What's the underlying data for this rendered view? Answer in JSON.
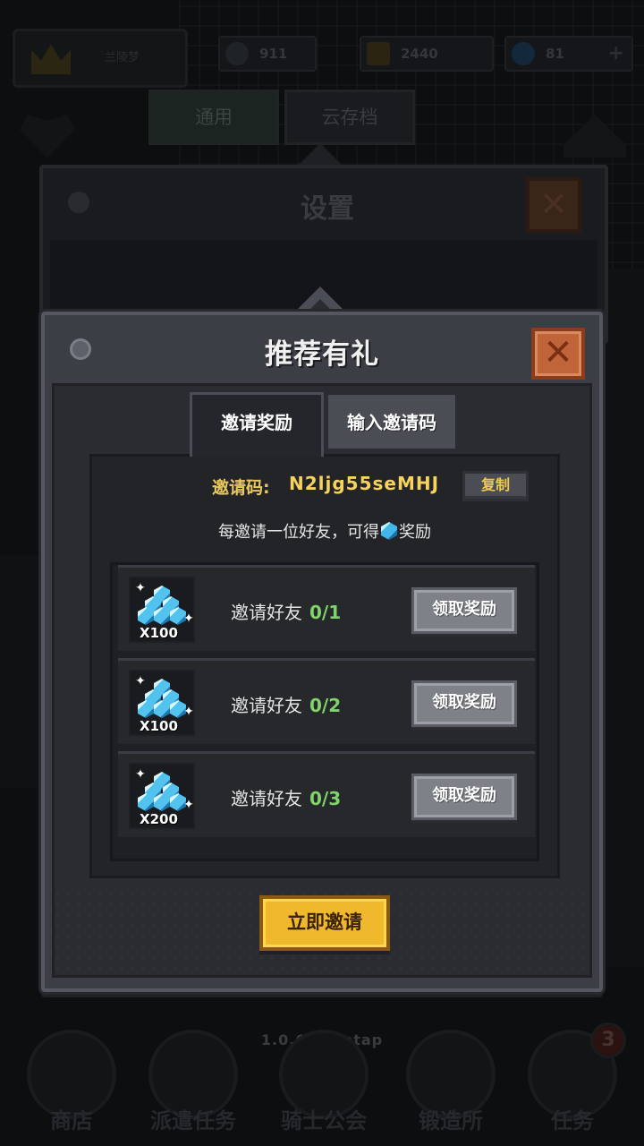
{
  "hud": {
    "player_name": "兰陵梦",
    "attack": "911",
    "gold": "2440",
    "gems": "81",
    "plus_label": "+"
  },
  "settings": {
    "title": "设置",
    "close_label": "✕",
    "tabs": [
      "通用",
      "云存档"
    ]
  },
  "modal": {
    "title": "推荐有礼",
    "close_label": "✕",
    "tabs": [
      {
        "label": "邀请奖励",
        "active": true
      },
      {
        "label": "输入邀请码",
        "active": false
      }
    ],
    "invite_code_label": "邀请码:",
    "invite_code_value": "N2ljg55seMHJ",
    "copy_label": "复制",
    "description_prefix": "每邀请一位好友，可得",
    "description_suffix": "奖励",
    "rewards": [
      {
        "quantity": "X100",
        "text": "邀请好友",
        "progress": "0/1",
        "button": "领取奖励"
      },
      {
        "quantity": "X100",
        "text": "邀请好友",
        "progress": "0/2",
        "button": "领取奖励"
      },
      {
        "quantity": "X200",
        "text": "邀请好友",
        "progress": "0/3",
        "button": "领取奖励"
      }
    ],
    "invite_button": "立即邀请"
  },
  "version": "1.0.69 Taptap",
  "bottom_nav": [
    {
      "label": "商店"
    },
    {
      "label": "派遣任务"
    },
    {
      "label": "骑士公会"
    },
    {
      "label": "锻造所"
    },
    {
      "label": "任务",
      "badge": "3"
    }
  ],
  "colors": {
    "gold_text": "#f5d35c",
    "progress_green": "#7fd36a",
    "close_orange": "#c0643a",
    "invite_yellow": "#f0b82c",
    "gem_blue": "#52c2ee"
  }
}
